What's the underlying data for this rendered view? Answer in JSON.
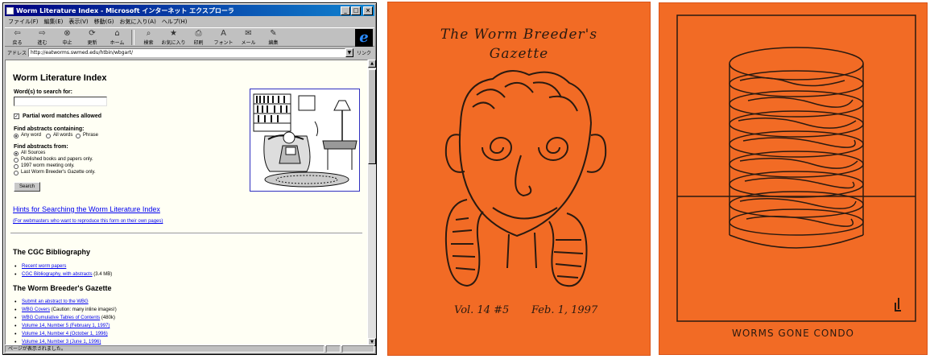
{
  "browser": {
    "title": "Worm Literature Index - Microsoft インターネット エクスプローラ",
    "menu": [
      "ファイル(F)",
      "編集(E)",
      "表示(V)",
      "移動(G)",
      "お気に入り(A)",
      "ヘルプ(H)"
    ],
    "toolbar": [
      {
        "label": "戻る",
        "icon": "back-arrow-icon"
      },
      {
        "label": "進む",
        "icon": "forward-arrow-icon"
      },
      {
        "label": "中止",
        "icon": "stop-icon"
      },
      {
        "label": "更新",
        "icon": "refresh-icon"
      },
      {
        "label": "ホーム",
        "icon": "home-icon"
      },
      {
        "label": "検索",
        "icon": "search-icon"
      },
      {
        "label": "お気に入り",
        "icon": "favorites-icon"
      },
      {
        "label": "印刷",
        "icon": "print-icon"
      },
      {
        "label": "フォント",
        "icon": "font-icon"
      },
      {
        "label": "メール",
        "icon": "mail-icon"
      },
      {
        "label": "編集",
        "icon": "edit-icon"
      }
    ],
    "address_label": "アドレス",
    "address_value": "http://eatworms.swmed.edu/htbin/wbgart/",
    "go_label": "リンク",
    "status_text": "ページが表示されました。"
  },
  "page": {
    "title": "Worm Literature Index",
    "search_label": "Word(s) to search for:",
    "partial_label": "Partial word matches allowed",
    "find_containing_label": "Find abstracts containing:",
    "containing_options": [
      "Any word",
      "All words",
      "Phrase"
    ],
    "find_from_label": "Find abstracts from:",
    "source_options": [
      "All Sources",
      "Published books and papers only.",
      "1997 worm meeting only.",
      "Last Worm Breeder's Gazette only."
    ],
    "search_button": "Search",
    "hints_link": "Hints for Searching the Worm Literature Index",
    "webmasters_link": "(For webmasters who want to reproduce this form on their own pages)",
    "cgc_heading": "The CGC Bibliography",
    "cgc_items": [
      {
        "link": "Recent worm papers",
        "note": ""
      },
      {
        "link": "CGC Bibliography, with abstracts",
        "note": " (3.4 MB)"
      }
    ],
    "wbg_heading": "The Worm Breeder's Gazette",
    "wbg_items": [
      {
        "link": "Submit an abstract to the WBG",
        "note": ""
      },
      {
        "link": "WBG Covers",
        "note": " (Caution: many inline images!)"
      },
      {
        "link": "WBG Cumulative Tables of Contents",
        "note": " (480k)"
      },
      {
        "link": "Volume 14, Number 5 (February 1, 1997)",
        "note": ""
      },
      {
        "link": "Volume 14, Number 4 (October 1, 1996)",
        "note": ""
      },
      {
        "link": "Volume 14, Number 3 (June 1, 1996)",
        "note": ""
      }
    ]
  },
  "covers": {
    "gazette_title_line1": "The Worm Breeder's",
    "gazette_title_line2": "Gazette",
    "gazette_volume": "Vol. 14 #5",
    "gazette_date": "Feb. 1, 1997",
    "condo_caption": "WORMS GONE CONDO"
  },
  "colors": {
    "cover_orange": "#f26b25",
    "link_blue": "#0000ee",
    "titlebar": "#000080"
  }
}
